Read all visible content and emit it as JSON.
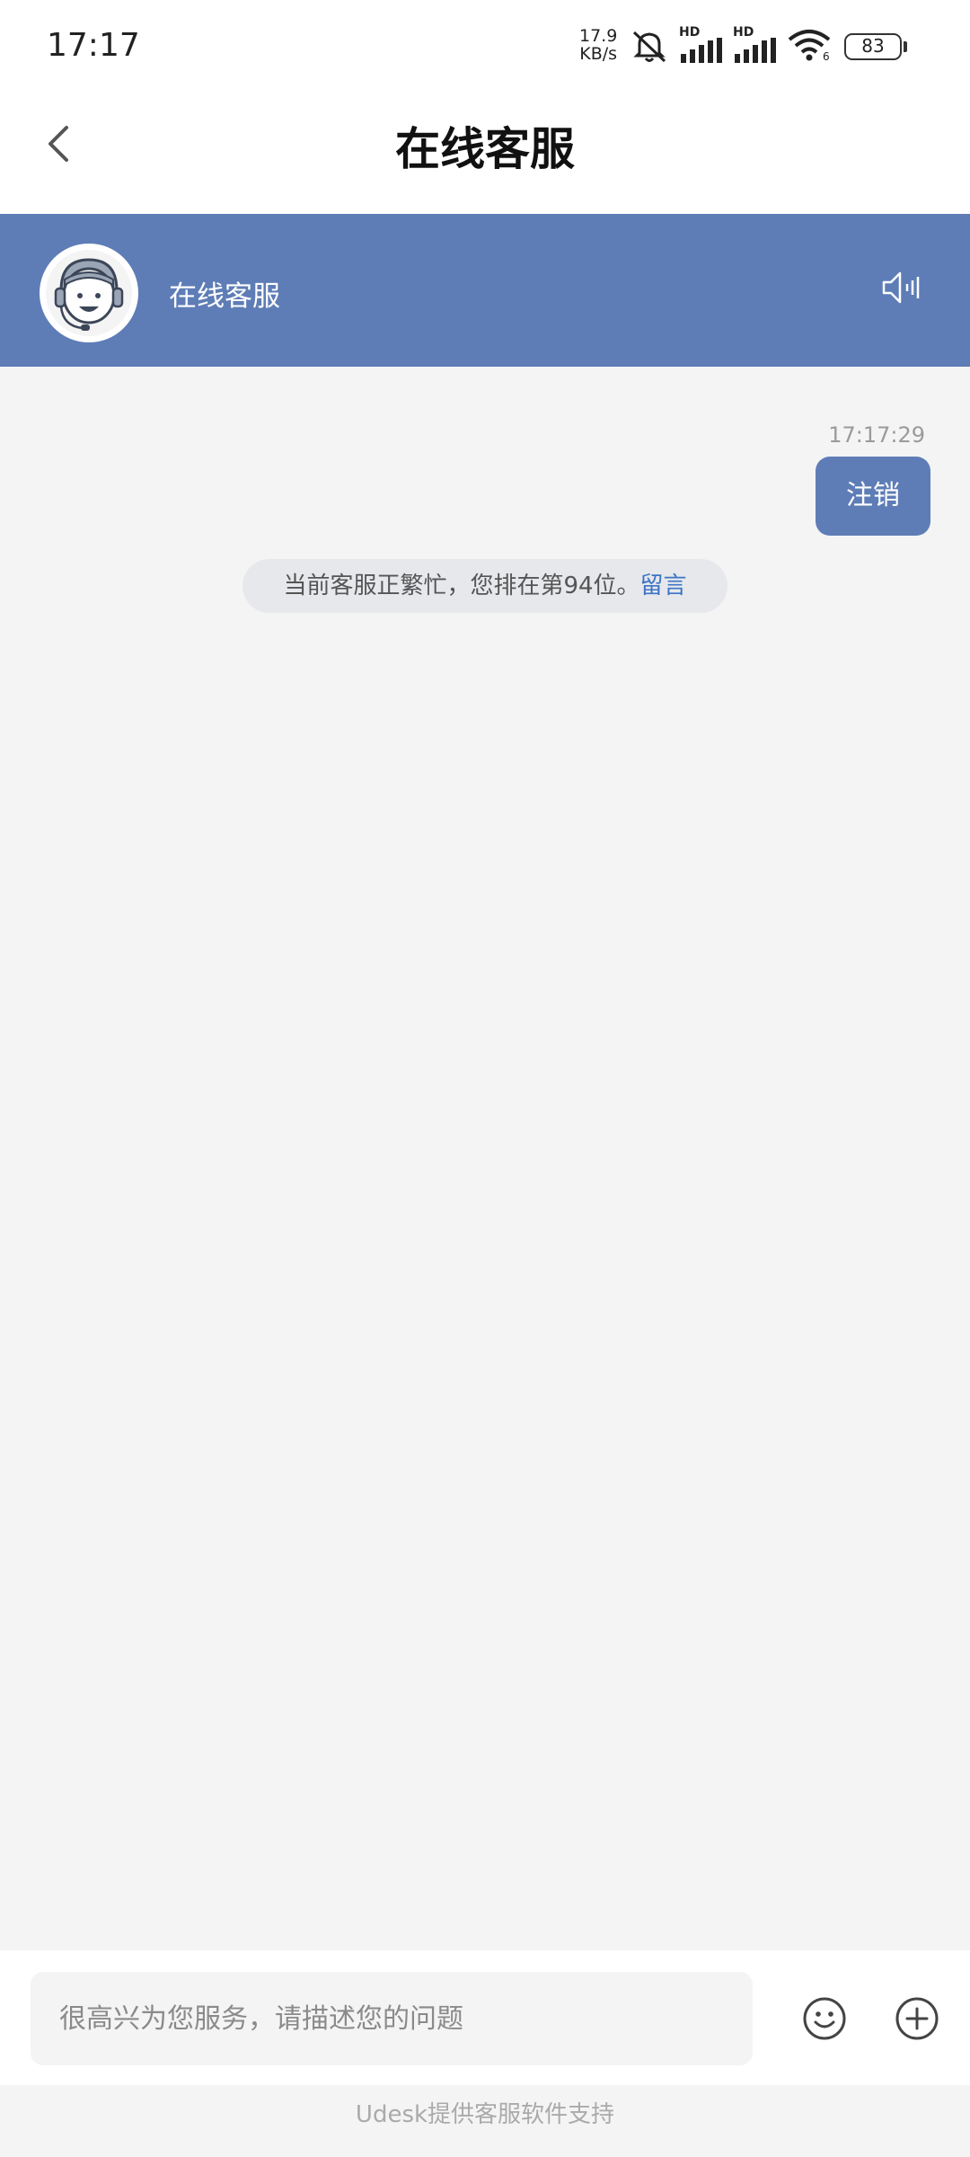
{
  "status_bar": {
    "time": "17:17",
    "net_speed_value": "17.9",
    "net_speed_unit": "KB/s",
    "signal_label_1": "HD",
    "signal_label_2": "HD",
    "wifi_label": "6",
    "battery": "83",
    "icons": [
      "mute-bell-icon",
      "signal-icon",
      "signal-icon",
      "wifi-icon",
      "battery-icon"
    ]
  },
  "nav": {
    "title": "在线客服",
    "back_icon": "chevron-left-icon"
  },
  "agent": {
    "name": "在线客服",
    "avatar_icon": "headset-agent-icon",
    "sound_icon": "speaker-icon",
    "header_color": "#5e7db7"
  },
  "chat": {
    "messages": [
      {
        "time": "17:17:29",
        "text": "注销",
        "from": "user"
      }
    ],
    "system_notice": {
      "text": "当前客服正繁忙，您排在第94位。",
      "link": "留言"
    }
  },
  "input": {
    "placeholder": "很高兴为您服务，请描述您的问题",
    "value": "",
    "emoji_icon": "emoji-icon",
    "plus_icon": "plus-circle-icon"
  },
  "footer": {
    "text": "Udesk提供客服软件支持"
  },
  "colors": {
    "accent": "#5e7db7",
    "link": "#3d74c5",
    "background": "#f4f4f4"
  }
}
